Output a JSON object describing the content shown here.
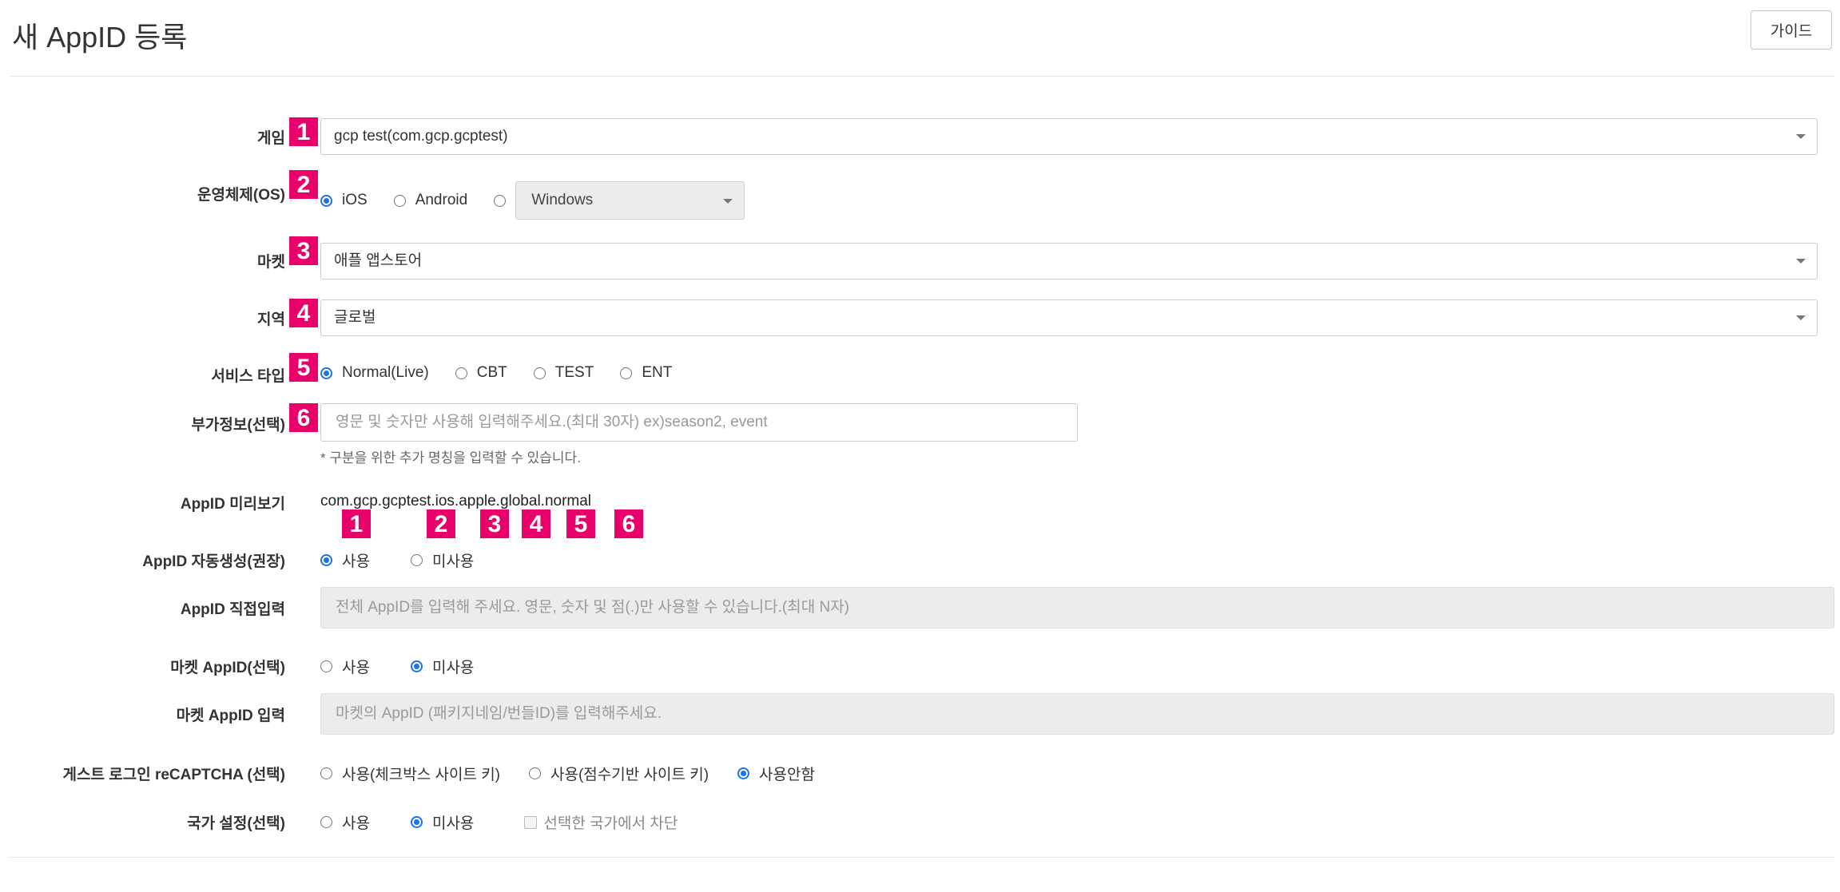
{
  "header": {
    "title": "새 AppID 등록",
    "guide_button": "가이드"
  },
  "fields": {
    "game": {
      "label": "게임",
      "badge": "1",
      "value": "gcp test(com.gcp.gcptest)"
    },
    "os": {
      "label": "운영체제(OS)",
      "badge": "2",
      "options": [
        "iOS",
        "Android"
      ],
      "selected": "iOS",
      "other_select": "Windows"
    },
    "market": {
      "label": "마켓",
      "badge": "3",
      "value": "애플 앱스토어"
    },
    "region": {
      "label": "지역",
      "badge": "4",
      "value": "글로벌"
    },
    "service_type": {
      "label": "서비스 타입",
      "badge": "5",
      "options": [
        "Normal(Live)",
        "CBT",
        "TEST",
        "ENT"
      ],
      "selected": "Normal(Live)"
    },
    "extra_info": {
      "label": "부가정보(선택)",
      "badge": "6",
      "placeholder": "영문 및 숫자만 사용해 입력해주세요.(최대 30자) ex)season2, event",
      "hint": "* 구분을 위한 추가 명칭을 입력할 수 있습니다."
    },
    "appid_preview": {
      "label": "AppID 미리보기",
      "value": "com.gcp.gcptest.ios.apple.global.normal",
      "badges": [
        "1",
        "2",
        "3",
        "4",
        "5",
        "6"
      ]
    },
    "appid_auto": {
      "label": "AppID 자동생성(권장)",
      "options": [
        "사용",
        "미사용"
      ],
      "selected": "사용"
    },
    "appid_direct": {
      "label": "AppID 직접입력",
      "placeholder": "전체 AppID를 입력해 주세요. 영문, 숫자 및 점(.)만 사용할 수 있습니다.(최대 N자)"
    },
    "market_appid": {
      "label": "마켓 AppID(선택)",
      "options": [
        "사용",
        "미사용"
      ],
      "selected": "미사용"
    },
    "market_appid_input": {
      "label": "마켓 AppID 입력",
      "placeholder": "마켓의 AppID (패키지네임/번들ID)를 입력해주세요."
    },
    "recaptcha": {
      "label": "게스트 로그인 reCAPTCHA (선택)",
      "options": [
        "사용(체크박스 사이트 키)",
        "사용(점수기반 사이트 키)",
        "사용안함"
      ],
      "selected": "사용안함"
    },
    "country": {
      "label": "국가 설정(선택)",
      "options": [
        "사용",
        "미사용"
      ],
      "selected": "미사용",
      "checkbox_label": "선택한 국가에서 차단"
    }
  },
  "colors": {
    "badge": "#e8006b",
    "radio_selected": "#1a73e8"
  }
}
